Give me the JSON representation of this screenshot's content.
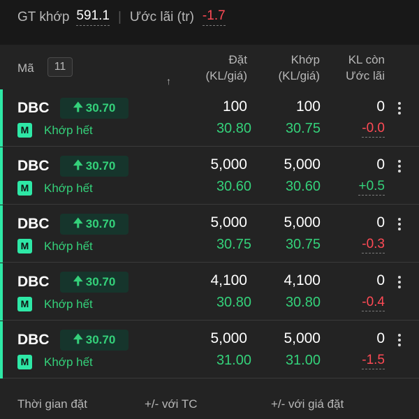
{
  "summary": {
    "gt_label": "GT khớp",
    "gt_value": "591.1",
    "uoc_label": "Ước lãi (tr)",
    "uoc_value": "-1.7"
  },
  "header": {
    "ma_label": "Mã",
    "count": "11",
    "sort_icon": "arrow-up",
    "dat_line1": "Đặt",
    "dat_line2": "(KL/giá)",
    "khop_line1": "Khớp",
    "khop_line2": "(KL/giá)",
    "kl_line1": "KL còn",
    "kl_line2": "Ước lãi"
  },
  "orders": [
    {
      "symbol": "DBC",
      "price_badge": "30.70",
      "type": "M",
      "status": "Khớp hết",
      "dat_qty": "100",
      "dat_price": "30.80",
      "khop_qty": "100",
      "khop_price": "30.75",
      "kl_con": "0",
      "uoc_lai": "-0.0",
      "uoc_sign": "neg"
    },
    {
      "symbol": "DBC",
      "price_badge": "30.70",
      "type": "M",
      "status": "Khớp hết",
      "dat_qty": "5,000",
      "dat_price": "30.60",
      "khop_qty": "5,000",
      "khop_price": "30.60",
      "kl_con": "0",
      "uoc_lai": "+0.5",
      "uoc_sign": "pos"
    },
    {
      "symbol": "DBC",
      "price_badge": "30.70",
      "type": "M",
      "status": "Khớp hết",
      "dat_qty": "5,000",
      "dat_price": "30.75",
      "khop_qty": "5,000",
      "khop_price": "30.75",
      "kl_con": "0",
      "uoc_lai": "-0.3",
      "uoc_sign": "neg"
    },
    {
      "symbol": "DBC",
      "price_badge": "30.70",
      "type": "M",
      "status": "Khớp hết",
      "dat_qty": "4,100",
      "dat_price": "30.80",
      "khop_qty": "4,100",
      "khop_price": "30.80",
      "kl_con": "0",
      "uoc_lai": "-0.4",
      "uoc_sign": "neg"
    },
    {
      "symbol": "DBC",
      "price_badge": "30.70",
      "type": "M",
      "status": "Khớp hết",
      "dat_qty": "5,000",
      "dat_price": "31.00",
      "khop_qty": "5,000",
      "khop_price": "31.00",
      "kl_con": "0",
      "uoc_lai": "-1.5",
      "uoc_sign": "neg"
    }
  ],
  "footer": {
    "time_label": "Thời gian đặt",
    "tc_label": "+/- với TC",
    "gia_dat_label": "+/- với giá đặt"
  },
  "colors": {
    "accent": "#2ee8a6",
    "up": "#34d17a",
    "down": "#ff4a55",
    "background": "#232323"
  }
}
